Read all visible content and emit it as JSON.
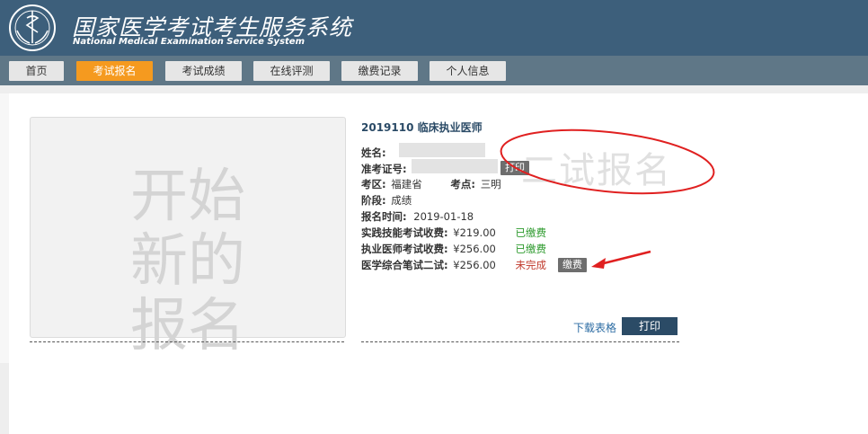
{
  "header": {
    "title": "国家医学考试考生服务系统",
    "subtitle": "National Medical Examination Service System"
  },
  "nav": {
    "tabs": [
      {
        "label": "首页"
      },
      {
        "label": "考试报名",
        "active": true
      },
      {
        "label": "考试成绩"
      },
      {
        "label": "在线评测"
      },
      {
        "label": "缴费记录"
      },
      {
        "label": "个人信息"
      }
    ]
  },
  "new_registration": {
    "text": "开始新的报名"
  },
  "record": {
    "title": "2019110 临床执业医师",
    "name_label": "姓名:",
    "admission_label": "准考证号:",
    "admission_print": "打印",
    "region_label": "考区:",
    "region_value": "福建省",
    "site_label": "考点:",
    "site_value": "三明",
    "stage_label": "阶段:",
    "stage_value": "成绩",
    "time_label": "报名时间:",
    "time_value": "2019-01-18",
    "fees": [
      {
        "label": "实践技能考试收费:",
        "amount": "¥219.00",
        "status": "已缴费"
      },
      {
        "label": "执业医师考试收费:",
        "amount": "¥256.00",
        "status": "已缴费"
      },
      {
        "label": "医学综合笔试二试:",
        "amount": "¥256.00",
        "status": "未完成",
        "action": "缴费"
      }
    ],
    "download_label": "下载表格",
    "print_label": "打印"
  },
  "annotation": {
    "text": "二试报名",
    "color": "#e02020"
  },
  "colors": {
    "header": "#3d5f7b",
    "nav": "#5f7787",
    "accent": "#f59a1f",
    "title": "#2a4a66"
  }
}
